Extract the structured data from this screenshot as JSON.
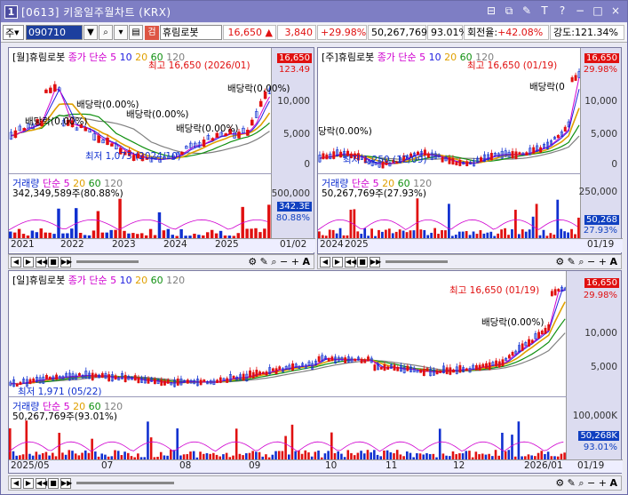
{
  "window": {
    "icon_label": "1",
    "title": "[0613] 키움일주월차트 (KRX)",
    "buttons": [
      "⊟",
      "⧉",
      "✎",
      "T",
      "?",
      "−",
      "□",
      "×"
    ]
  },
  "toolbar": {
    "period": "주",
    "code": "090710",
    "stock_name": "휴림로봇",
    "g_badge": "검",
    "price": "16,650",
    "change": "3,840",
    "change_pct": "+29.98%",
    "volume": "50,267,769",
    "vol_ratio": "93.01%",
    "turnover_label": "회전율",
    "turnover": "+42.08%",
    "strength_label": "강도",
    "strength": "121.34%"
  },
  "monthly": {
    "header": {
      "name": "[월]휴림로봇",
      "ma": "종가 단순 5",
      "ma10": "10",
      "ma20": "20",
      "ma60": "60",
      "ma120": "120"
    },
    "hi_label": "최고 16,650 (2026/01)",
    "lo_label": "최저 1,073 (2024/10)",
    "div_labels": [
      "배당락(0.00%)",
      "배당락(0.00%)",
      "배당락(0.00%)",
      "배당락(0.00%)",
      "배당락(0.00%)"
    ],
    "price_tag": "16,650",
    "pct_tag": "123.49",
    "y_ticks": [
      "10,000",
      "5,000",
      "0"
    ],
    "vol_header": {
      "name": "거래량",
      "ma": "단순 5",
      "ma20": "20",
      "ma60": "60",
      "ma120": "120"
    },
    "vol_info": "342,349,589주(80.88%)",
    "vol_tag": "342.3E",
    "vol_pct": "80.88%",
    "vol_ticks": [
      "500,000"
    ],
    "x_labels": [
      "2021",
      "2022",
      "2023",
      "2024",
      "2025"
    ],
    "date": "01/02"
  },
  "weekly": {
    "header": {
      "name": "[주]휴림로봇",
      "ma": "종가 단순 5",
      "ma10": "10",
      "ma20": "20",
      "ma60": "60",
      "ma120": "120"
    },
    "hi_label": "최고 16,650 (01/19)",
    "lo_label": "최저 1,250 (12/09)",
    "div_labels": [
      "배당락(0",
      "당락(0.00%)"
    ],
    "price_tag": "16,650",
    "pct_tag": "29.98%",
    "y_ticks": [
      "10,000",
      "5,000",
      "0"
    ],
    "vol_header": {
      "name": "거래량",
      "ma": "단순 5",
      "ma20": "20",
      "ma60": "60",
      "ma120": "120"
    },
    "vol_info": "50,267,769주(27.93%)",
    "vol_tag": "50,268",
    "vol_pct": "27.93%",
    "vol_ticks": [
      "250,000"
    ],
    "x_labels": [
      "2024",
      "2025"
    ],
    "date": "01/19"
  },
  "daily": {
    "header": {
      "name": "[일]휴림로봇",
      "ma": "종가 단순 5",
      "ma10": "10",
      "ma20": "20",
      "ma60": "60",
      "ma120": "120"
    },
    "hi_label": "최고 16,650 (01/19)",
    "lo_label": "최저 1,971 (05/22)",
    "div_labels": [
      "배당락(0.00%)"
    ],
    "price_tag": "16,650",
    "pct_tag": "29.98%",
    "y_ticks": [
      "10,000",
      "5,000"
    ],
    "vol_header": {
      "name": "거래량",
      "ma": "단순 5",
      "ma20": "20",
      "ma60": "60",
      "ma120": "120"
    },
    "vol_info": "50,267,769주(93.01%)",
    "vol_tag": "50,268K",
    "vol_pct": "93.01%",
    "vol_ticks": [
      "100,000K"
    ],
    "x_labels": [
      "2025/05",
      "07",
      "08",
      "09",
      "10",
      "11",
      "12",
      "2026/01"
    ],
    "date": "01/19"
  },
  "controls": [
    "◀",
    "▶",
    "◀◀",
    "■",
    "▶▶",
    "A"
  ],
  "colors": {
    "up": "#e01010",
    "down": "#1030d0",
    "ma5": "#d000d0",
    "ma10": "#2020e0",
    "ma20": "#e0a000",
    "ma60": "#109010",
    "ma120": "#808080"
  }
}
